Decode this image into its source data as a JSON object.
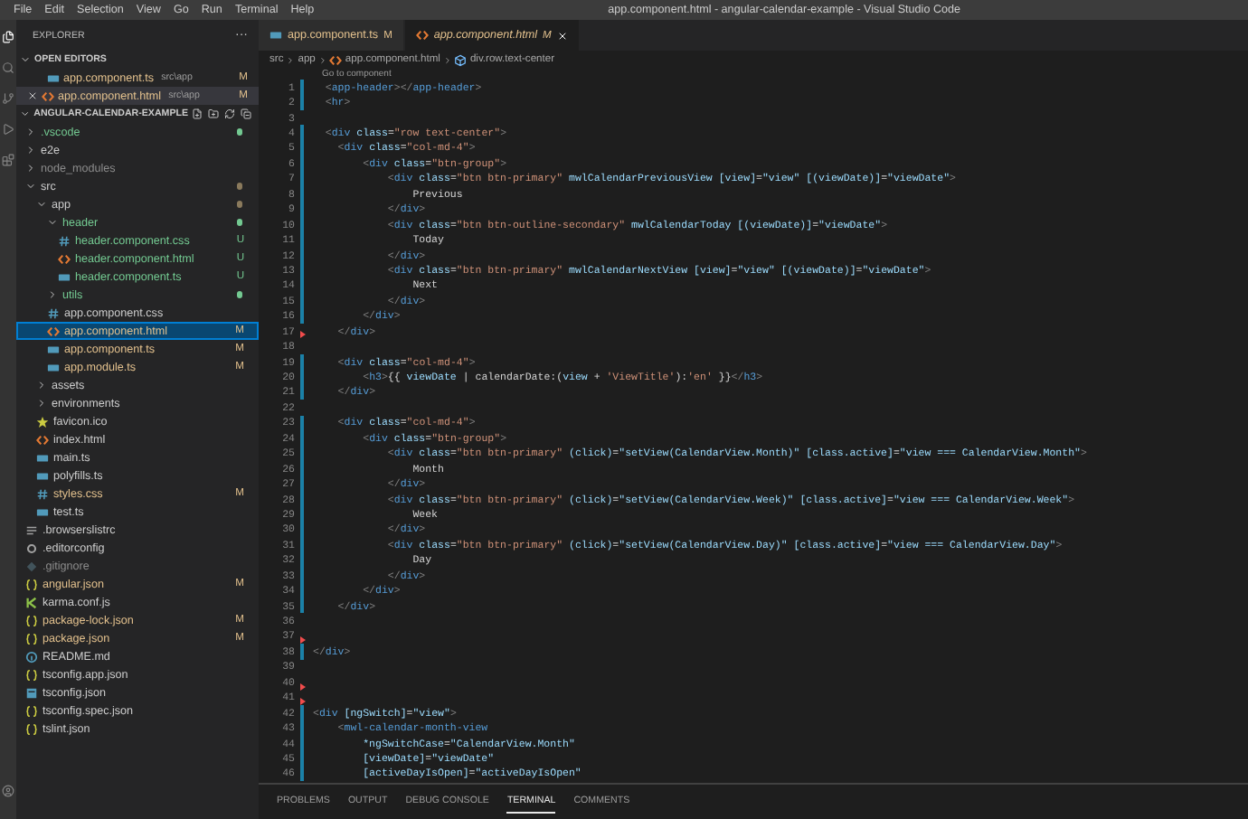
{
  "menu": [
    "File",
    "Edit",
    "Selection",
    "View",
    "Go",
    "Run",
    "Terminal",
    "Help"
  ],
  "window": {
    "title": "app.component.html - angular-calendar-example - Visual Studio Code"
  },
  "sidebar": {
    "title": "EXPLORER",
    "more": "···",
    "open_editors": {
      "title": "OPEN EDITORS",
      "items": [
        {
          "name": "app.component.ts",
          "kind": "ts",
          "path": "src\\app",
          "badge": "M",
          "selected": false
        },
        {
          "name": "app.component.html",
          "kind": "html",
          "path": "src\\app",
          "badge": "M",
          "selected": true
        }
      ]
    },
    "project": {
      "title": "ANGULAR-CALENDAR-EXAMPLE",
      "tree": [
        {
          "name": ".vscode",
          "kind": "folder",
          "modified": false,
          "untracked": true,
          "ignored": false,
          "color": "#73c991",
          "expanded": false,
          "selected": false
        },
        {
          "name": "e2e",
          "kind": "folder",
          "modified": false,
          "untracked": false,
          "ignored": false,
          "expanded": false,
          "selected": false
        },
        {
          "name": "node_modules",
          "kind": "folder",
          "modified": false,
          "untracked": false,
          "ignored": true,
          "expanded": false,
          "selected": false
        },
        {
          "name": "src",
          "kind": "folder",
          "modified": false,
          "untracked": false,
          "ignored": false,
          "color": "#8a7a5c",
          "expanded": true,
          "selected": false,
          "children": [
            {
              "name": "app",
              "kind": "folder",
              "modified": false,
              "untracked": false,
              "ignored": false,
              "color": "#8a7a5c",
              "expanded": true,
              "selected": false,
              "children": [
                {
                  "name": "header",
                  "kind": "folder",
                  "modified": false,
                  "untracked": true,
                  "ignored": false,
                  "color": "#73c991",
                  "expanded": true,
                  "selected": false,
                  "children": [
                    {
                      "name": "header.component.css",
                      "kind": "css",
                      "modified": false,
                      "untracked": true,
                      "ignored": false,
                      "badge": "U",
                      "selected": false
                    },
                    {
                      "name": "header.component.html",
                      "kind": "html",
                      "modified": false,
                      "untracked": true,
                      "ignored": false,
                      "badge": "U",
                      "selected": false
                    },
                    {
                      "name": "header.component.ts",
                      "kind": "ts",
                      "modified": false,
                      "untracked": true,
                      "ignored": false,
                      "badge": "U",
                      "selected": false
                    }
                  ]
                },
                {
                  "name": "utils",
                  "kind": "folder",
                  "modified": false,
                  "untracked": true,
                  "ignored": false,
                  "color": "#73c991",
                  "expanded": false,
                  "selected": false
                },
                {
                  "name": "app.component.css",
                  "kind": "css",
                  "modified": false,
                  "untracked": false,
                  "ignored": false,
                  "selected": false
                },
                {
                  "name": "app.component.html",
                  "kind": "html",
                  "modified": true,
                  "untracked": false,
                  "ignored": false,
                  "badge": "M",
                  "selected": true
                },
                {
                  "name": "app.component.ts",
                  "kind": "ts",
                  "modified": true,
                  "untracked": false,
                  "ignored": false,
                  "badge": "M",
                  "selected": false
                },
                {
                  "name": "app.module.ts",
                  "kind": "ts",
                  "modified": true,
                  "untracked": false,
                  "ignored": false,
                  "badge": "M",
                  "selected": false
                }
              ]
            },
            {
              "name": "assets",
              "kind": "folder",
              "modified": false,
              "untracked": false,
              "ignored": false,
              "expanded": false,
              "selected": false
            },
            {
              "name": "environments",
              "kind": "folder",
              "modified": false,
              "untracked": false,
              "ignored": false,
              "expanded": false,
              "selected": false
            },
            {
              "name": "favicon.ico",
              "kind": "star",
              "modified": false,
              "untracked": false,
              "ignored": false,
              "selected": false
            },
            {
              "name": "index.html",
              "kind": "html",
              "modified": false,
              "untracked": false,
              "ignored": false,
              "selected": false
            },
            {
              "name": "main.ts",
              "kind": "ts",
              "modified": false,
              "untracked": false,
              "ignored": false,
              "selected": false
            },
            {
              "name": "polyfills.ts",
              "kind": "ts",
              "modified": false,
              "untracked": false,
              "ignored": false,
              "selected": false
            },
            {
              "name": "styles.css",
              "kind": "css",
              "modified": true,
              "untracked": false,
              "ignored": false,
              "badge": "M",
              "selected": false
            },
            {
              "name": "test.ts",
              "kind": "ts",
              "modified": false,
              "untracked": false,
              "ignored": false,
              "selected": false
            }
          ]
        },
        {
          "name": ".browserslistrc",
          "kind": "lines",
          "modified": false,
          "untracked": false,
          "ignored": false,
          "selected": false
        },
        {
          "name": ".editorconfig",
          "kind": "gear",
          "modified": false,
          "untracked": false,
          "ignored": false,
          "selected": false
        },
        {
          "name": ".gitignore",
          "kind": "git",
          "modified": false,
          "untracked": false,
          "ignored": true,
          "selected": false
        },
        {
          "name": "angular.json",
          "kind": "json",
          "modified": true,
          "untracked": false,
          "ignored": false,
          "badge": "M",
          "selected": false
        },
        {
          "name": "karma.conf.js",
          "kind": "karma",
          "modified": false,
          "untracked": false,
          "ignored": false,
          "selected": false
        },
        {
          "name": "package-lock.json",
          "kind": "json",
          "modified": true,
          "untracked": false,
          "ignored": false,
          "badge": "M",
          "selected": false
        },
        {
          "name": "package.json",
          "kind": "json",
          "modified": true,
          "untracked": false,
          "ignored": false,
          "badge": "M",
          "selected": false
        },
        {
          "name": "README.md",
          "kind": "info",
          "modified": false,
          "untracked": false,
          "ignored": false,
          "selected": false
        },
        {
          "name": "tsconfig.app.json",
          "kind": "json",
          "modified": false,
          "untracked": false,
          "ignored": false,
          "selected": false
        },
        {
          "name": "tsconfig.json",
          "kind": "tsconfig",
          "modified": false,
          "untracked": false,
          "ignored": false,
          "selected": false
        },
        {
          "name": "tsconfig.spec.json",
          "kind": "json",
          "modified": false,
          "untracked": false,
          "ignored": false,
          "selected": false
        },
        {
          "name": "tslint.json",
          "kind": "json",
          "modified": false,
          "untracked": false,
          "ignored": false,
          "selected": false
        }
      ]
    }
  },
  "tabs": [
    {
      "label": "app.component.ts",
      "kind": "ts",
      "badge": "M",
      "selected": false
    },
    {
      "label": "app.component.html",
      "kind": "html",
      "badge": "M",
      "selected": true
    }
  ],
  "breadcrumb": [
    {
      "label": "src",
      "kind": "plain"
    },
    {
      "label": "app",
      "kind": "plain"
    },
    {
      "label": "app.component.html",
      "kind": "html"
    },
    {
      "label": "div.row.text-center",
      "kind": "symbol"
    }
  ],
  "editor": {
    "codelens": "Go to component",
    "lines": [
      {
        "n": "1",
        "kind": "modified",
        "tokens": [
          {
            "kind": "p",
            "text": "  <"
          },
          {
            "kind": "t",
            "text": "app-header"
          },
          {
            "kind": "p",
            "text": "></"
          },
          {
            "kind": "t",
            "text": "app-header"
          },
          {
            "kind": "p",
            "text": ">"
          }
        ]
      },
      {
        "n": "2",
        "kind": "modified",
        "tokens": [
          {
            "kind": "p",
            "text": "  <"
          },
          {
            "kind": "t",
            "text": "hr"
          },
          {
            "kind": "p",
            "text": ">"
          }
        ]
      },
      {
        "n": "3",
        "kind": "plain"
      },
      {
        "n": "4",
        "kind": "modified",
        "tokens": [
          {
            "kind": "p",
            "text": "  <"
          },
          {
            "kind": "t",
            "text": "div"
          },
          {
            "kind": "a",
            "text": " class"
          },
          {
            "kind": "x",
            "text": "="
          },
          {
            "kind": "s",
            "text": "\"row text-center\""
          },
          {
            "kind": "p",
            "text": ">"
          }
        ]
      },
      {
        "n": "5",
        "kind": "modified",
        "tokens": [
          {
            "kind": "p",
            "text": "    <"
          },
          {
            "kind": "t",
            "text": "div"
          },
          {
            "kind": "a",
            "text": " class"
          },
          {
            "kind": "x",
            "text": "="
          },
          {
            "kind": "s",
            "text": "\"col-md-4\""
          },
          {
            "kind": "p",
            "text": ">"
          }
        ]
      },
      {
        "n": "6",
        "kind": "modified",
        "tokens": [
          {
            "kind": "p",
            "text": "        <"
          },
          {
            "kind": "t",
            "text": "div"
          },
          {
            "kind": "a",
            "text": " class"
          },
          {
            "kind": "x",
            "text": "="
          },
          {
            "kind": "s",
            "text": "\"btn-group\""
          },
          {
            "kind": "p",
            "text": ">"
          }
        ]
      },
      {
        "n": "7",
        "kind": "modified",
        "tokens": [
          {
            "kind": "p",
            "text": "            <"
          },
          {
            "kind": "t",
            "text": "div"
          },
          {
            "kind": "a",
            "text": " class"
          },
          {
            "kind": "x",
            "text": "="
          },
          {
            "kind": "s",
            "text": "\"btn btn-primary\""
          },
          {
            "kind": "a",
            "text": " mwlCalendarPreviousView [view]"
          },
          {
            "kind": "x",
            "text": "="
          },
          {
            "kind": "e",
            "text": "\"view\""
          },
          {
            "kind": "a",
            "text": " [(viewDate)]"
          },
          {
            "kind": "x",
            "text": "="
          },
          {
            "kind": "e",
            "text": "\"viewDate\""
          },
          {
            "kind": "p",
            "text": ">"
          }
        ]
      },
      {
        "n": "8",
        "kind": "modified",
        "tokens": [
          {
            "kind": "x",
            "text": "                Previous"
          }
        ]
      },
      {
        "n": "9",
        "kind": "modified",
        "tokens": [
          {
            "kind": "p",
            "text": "            </"
          },
          {
            "kind": "t",
            "text": "div"
          },
          {
            "kind": "p",
            "text": ">"
          }
        ]
      },
      {
        "n": "10",
        "kind": "modified",
        "tokens": [
          {
            "kind": "p",
            "text": "            <"
          },
          {
            "kind": "t",
            "text": "div"
          },
          {
            "kind": "a",
            "text": " class"
          },
          {
            "kind": "x",
            "text": "="
          },
          {
            "kind": "s",
            "text": "\"btn btn-outline-secondary\""
          },
          {
            "kind": "a",
            "text": " mwlCalendarToday [(viewDate)]"
          },
          {
            "kind": "x",
            "text": "="
          },
          {
            "kind": "e",
            "text": "\"viewDate\""
          },
          {
            "kind": "p",
            "text": ">"
          }
        ]
      },
      {
        "n": "11",
        "kind": "modified",
        "tokens": [
          {
            "kind": "x",
            "text": "                Today"
          }
        ]
      },
      {
        "n": "12",
        "kind": "modified",
        "tokens": [
          {
            "kind": "p",
            "text": "            </"
          },
          {
            "kind": "t",
            "text": "div"
          },
          {
            "kind": "p",
            "text": ">"
          }
        ]
      },
      {
        "n": "13",
        "kind": "modified",
        "tokens": [
          {
            "kind": "p",
            "text": "            <"
          },
          {
            "kind": "t",
            "text": "div"
          },
          {
            "kind": "a",
            "text": " class"
          },
          {
            "kind": "x",
            "text": "="
          },
          {
            "kind": "s",
            "text": "\"btn btn-primary\""
          },
          {
            "kind": "a",
            "text": " mwlCalendarNextView [view]"
          },
          {
            "kind": "x",
            "text": "="
          },
          {
            "kind": "e",
            "text": "\"view\""
          },
          {
            "kind": "a",
            "text": " [(viewDate)]"
          },
          {
            "kind": "x",
            "text": "="
          },
          {
            "kind": "e",
            "text": "\"viewDate\""
          },
          {
            "kind": "p",
            "text": ">"
          }
        ]
      },
      {
        "n": "14",
        "kind": "modified",
        "tokens": [
          {
            "kind": "x",
            "text": "                Next"
          }
        ]
      },
      {
        "n": "15",
        "kind": "modified",
        "tokens": [
          {
            "kind": "p",
            "text": "            </"
          },
          {
            "kind": "t",
            "text": "div"
          },
          {
            "kind": "p",
            "text": ">"
          }
        ]
      },
      {
        "n": "16",
        "kind": "modified",
        "tokens": [
          {
            "kind": "p",
            "text": "        </"
          },
          {
            "kind": "t",
            "text": "div"
          },
          {
            "kind": "p",
            "text": ">"
          }
        ]
      },
      {
        "n": "17",
        "kind": "deleted",
        "tokens": [
          {
            "kind": "p",
            "text": "    </"
          },
          {
            "kind": "t",
            "text": "div"
          },
          {
            "kind": "p",
            "text": ">"
          }
        ]
      },
      {
        "n": "18",
        "kind": "plain"
      },
      {
        "n": "19",
        "kind": "modified",
        "tokens": [
          {
            "kind": "p",
            "text": "    <"
          },
          {
            "kind": "t",
            "text": "div"
          },
          {
            "kind": "a",
            "text": " class"
          },
          {
            "kind": "x",
            "text": "="
          },
          {
            "kind": "s",
            "text": "\"col-md-4\""
          },
          {
            "kind": "p",
            "text": ">"
          }
        ]
      },
      {
        "n": "20",
        "kind": "modified",
        "tokens": [
          {
            "kind": "p",
            "text": "        <"
          },
          {
            "kind": "t",
            "text": "h3"
          },
          {
            "kind": "p",
            "text": ">"
          },
          {
            "kind": "x",
            "text": "{{ "
          },
          {
            "kind": "e",
            "text": "viewDate"
          },
          {
            "kind": "x",
            "text": " | calendarDate:("
          },
          {
            "kind": "e",
            "text": "view"
          },
          {
            "kind": "x",
            "text": " + "
          },
          {
            "kind": "s",
            "text": "'ViewTitle'"
          },
          {
            "kind": "x",
            "text": "):"
          },
          {
            "kind": "s",
            "text": "'en'"
          },
          {
            "kind": "x",
            "text": " }}"
          },
          {
            "kind": "p",
            "text": "</"
          },
          {
            "kind": "t",
            "text": "h3"
          },
          {
            "kind": "p",
            "text": ">"
          }
        ]
      },
      {
        "n": "21",
        "kind": "modified",
        "tokens": [
          {
            "kind": "p",
            "text": "    </"
          },
          {
            "kind": "t",
            "text": "div"
          },
          {
            "kind": "p",
            "text": ">"
          }
        ]
      },
      {
        "n": "22",
        "kind": "plain"
      },
      {
        "n": "23",
        "kind": "modified",
        "tokens": [
          {
            "kind": "p",
            "text": "    <"
          },
          {
            "kind": "t",
            "text": "div"
          },
          {
            "kind": "a",
            "text": " class"
          },
          {
            "kind": "x",
            "text": "="
          },
          {
            "kind": "s",
            "text": "\"col-md-4\""
          },
          {
            "kind": "p",
            "text": ">"
          }
        ]
      },
      {
        "n": "24",
        "kind": "modified",
        "tokens": [
          {
            "kind": "p",
            "text": "        <"
          },
          {
            "kind": "t",
            "text": "div"
          },
          {
            "kind": "a",
            "text": " class"
          },
          {
            "kind": "x",
            "text": "="
          },
          {
            "kind": "s",
            "text": "\"btn-group\""
          },
          {
            "kind": "p",
            "text": ">"
          }
        ]
      },
      {
        "n": "25",
        "kind": "modified",
        "tokens": [
          {
            "kind": "p",
            "text": "            <"
          },
          {
            "kind": "t",
            "text": "div"
          },
          {
            "kind": "a",
            "text": " class"
          },
          {
            "kind": "x",
            "text": "="
          },
          {
            "kind": "s",
            "text": "\"btn btn-primary\""
          },
          {
            "kind": "a",
            "text": " (click)"
          },
          {
            "kind": "x",
            "text": "="
          },
          {
            "kind": "e",
            "text": "\"setView(CalendarView.Month)\""
          },
          {
            "kind": "a",
            "text": " [class.active]"
          },
          {
            "kind": "x",
            "text": "="
          },
          {
            "kind": "e",
            "text": "\"view === CalendarView.Month\""
          },
          {
            "kind": "p",
            "text": ">"
          }
        ]
      },
      {
        "n": "26",
        "kind": "modified",
        "tokens": [
          {
            "kind": "x",
            "text": "                Month"
          }
        ]
      },
      {
        "n": "27",
        "kind": "modified",
        "tokens": [
          {
            "kind": "p",
            "text": "            </"
          },
          {
            "kind": "t",
            "text": "div"
          },
          {
            "kind": "p",
            "text": ">"
          }
        ]
      },
      {
        "n": "28",
        "kind": "modified",
        "tokens": [
          {
            "kind": "p",
            "text": "            <"
          },
          {
            "kind": "t",
            "text": "div"
          },
          {
            "kind": "a",
            "text": " class"
          },
          {
            "kind": "x",
            "text": "="
          },
          {
            "kind": "s",
            "text": "\"btn btn-primary\""
          },
          {
            "kind": "a",
            "text": " (click)"
          },
          {
            "kind": "x",
            "text": "="
          },
          {
            "kind": "e",
            "text": "\"setView(CalendarView.Week)\""
          },
          {
            "kind": "a",
            "text": " [class.active]"
          },
          {
            "kind": "x",
            "text": "="
          },
          {
            "kind": "e",
            "text": "\"view === CalendarView.Week\""
          },
          {
            "kind": "p",
            "text": ">"
          }
        ]
      },
      {
        "n": "29",
        "kind": "modified",
        "tokens": [
          {
            "kind": "x",
            "text": "                Week"
          }
        ]
      },
      {
        "n": "30",
        "kind": "modified",
        "tokens": [
          {
            "kind": "p",
            "text": "            </"
          },
          {
            "kind": "t",
            "text": "div"
          },
          {
            "kind": "p",
            "text": ">"
          }
        ]
      },
      {
        "n": "31",
        "kind": "modified",
        "tokens": [
          {
            "kind": "p",
            "text": "            <"
          },
          {
            "kind": "t",
            "text": "div"
          },
          {
            "kind": "a",
            "text": " class"
          },
          {
            "kind": "x",
            "text": "="
          },
          {
            "kind": "s",
            "text": "\"btn btn-primary\""
          },
          {
            "kind": "a",
            "text": " (click)"
          },
          {
            "kind": "x",
            "text": "="
          },
          {
            "kind": "e",
            "text": "\"setView(CalendarView.Day)\""
          },
          {
            "kind": "a",
            "text": " [class.active]"
          },
          {
            "kind": "x",
            "text": "="
          },
          {
            "kind": "e",
            "text": "\"view === CalendarView.Day\""
          },
          {
            "kind": "p",
            "text": ">"
          }
        ]
      },
      {
        "n": "32",
        "kind": "modified",
        "tokens": [
          {
            "kind": "x",
            "text": "                Day"
          }
        ]
      },
      {
        "n": "33",
        "kind": "modified",
        "tokens": [
          {
            "kind": "p",
            "text": "            </"
          },
          {
            "kind": "t",
            "text": "div"
          },
          {
            "kind": "p",
            "text": ">"
          }
        ]
      },
      {
        "n": "34",
        "kind": "modified",
        "tokens": [
          {
            "kind": "p",
            "text": "        </"
          },
          {
            "kind": "t",
            "text": "div"
          },
          {
            "kind": "p",
            "text": ">"
          }
        ]
      },
      {
        "n": "35",
        "kind": "modified",
        "tokens": [
          {
            "kind": "p",
            "text": "    </"
          },
          {
            "kind": "t",
            "text": "div"
          },
          {
            "kind": "p",
            "text": ">"
          }
        ]
      },
      {
        "n": "36",
        "kind": "plain"
      },
      {
        "n": "37",
        "kind": "deleted"
      },
      {
        "n": "38",
        "kind": "modified",
        "tokens": [
          {
            "kind": "p",
            "text": "</"
          },
          {
            "kind": "t",
            "text": "div"
          },
          {
            "kind": "p",
            "text": ">"
          }
        ]
      },
      {
        "n": "39",
        "kind": "plain"
      },
      {
        "n": "40",
        "kind": "deleted"
      },
      {
        "n": "41",
        "kind": "deleted"
      },
      {
        "n": "42",
        "kind": "modified",
        "tokens": [
          {
            "kind": "p",
            "text": "<"
          },
          {
            "kind": "t",
            "text": "div"
          },
          {
            "kind": "a",
            "text": " [ngSwitch]"
          },
          {
            "kind": "x",
            "text": "="
          },
          {
            "kind": "e",
            "text": "\"view\""
          },
          {
            "kind": "p",
            "text": ">"
          }
        ]
      },
      {
        "n": "43",
        "kind": "modified",
        "tokens": [
          {
            "kind": "p",
            "text": "    <"
          },
          {
            "kind": "t",
            "text": "mwl-calendar-month-view"
          }
        ]
      },
      {
        "n": "44",
        "kind": "modified",
        "tokens": [
          {
            "kind": "a",
            "text": "        *ngSwitchCase"
          },
          {
            "kind": "x",
            "text": "="
          },
          {
            "kind": "e",
            "text": "\"CalendarView.Month\""
          }
        ]
      },
      {
        "n": "45",
        "kind": "modified",
        "tokens": [
          {
            "kind": "a",
            "text": "        [viewDate]"
          },
          {
            "kind": "x",
            "text": "="
          },
          {
            "kind": "e",
            "text": "\"viewDate\""
          }
        ]
      },
      {
        "n": "46",
        "kind": "modified",
        "tokens": [
          {
            "kind": "a",
            "text": "        [activeDayIsOpen]"
          },
          {
            "kind": "x",
            "text": "="
          },
          {
            "kind": "e",
            "text": "\"activeDayIsOpen\""
          }
        ]
      }
    ]
  },
  "panel": {
    "tabs": [
      {
        "label": "PROBLEMS",
        "selected": false
      },
      {
        "label": "OUTPUT",
        "selected": false
      },
      {
        "label": "DEBUG CONSOLE",
        "selected": false
      },
      {
        "label": "TERMINAL",
        "selected": true
      },
      {
        "label": "COMMENTS",
        "selected": false
      }
    ]
  }
}
